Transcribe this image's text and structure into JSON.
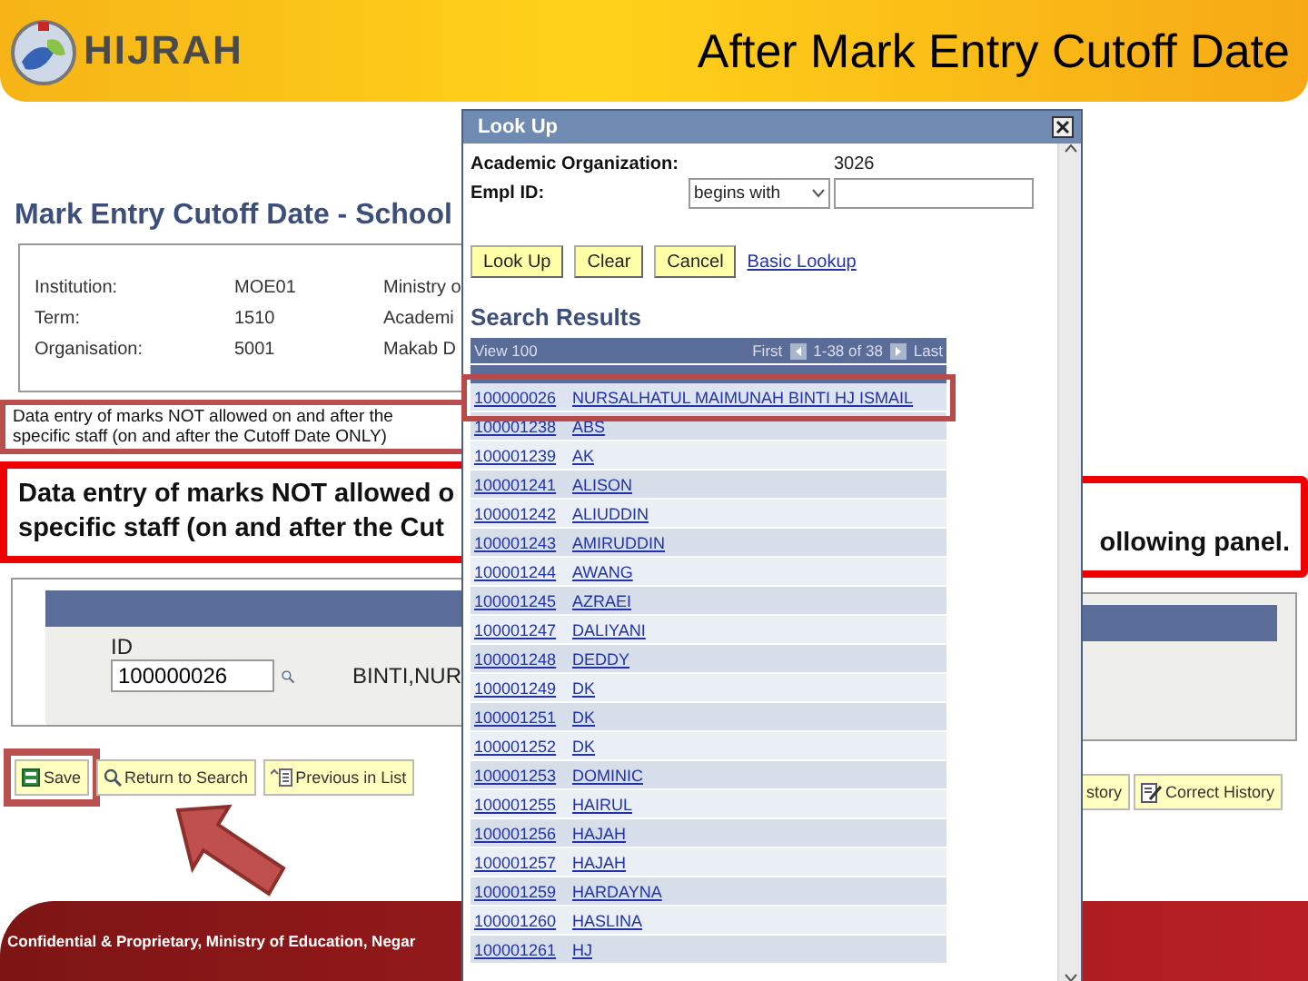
{
  "slide": {
    "logo_text": "HIJRAH",
    "title": "After Mark Entry Cutoff Date",
    "footer": "Confidential & Proprietary, Ministry of Education, Negar"
  },
  "page": {
    "title": "Mark Entry Cutoff Date - School",
    "fields": [
      {
        "label": "Institution:",
        "code": "MOE01",
        "description": "Ministry o"
      },
      {
        "label": "Term:",
        "code": "1510",
        "description": "Academi"
      },
      {
        "label": "Organisation:",
        "code": "5001",
        "description": "Makab D"
      }
    ],
    "notice": [
      "Data entry of marks NOT allowed on and after the",
      "specific staff (on and after the Cutoff Date  ONLY)"
    ],
    "callout": [
      "Data entry of marks NOT allowed o",
      "specific staff (on and after the Cut"
    ],
    "callout_end": "ollowing panel.",
    "id_label": "ID",
    "id_value": "100000026",
    "name": "BINTI,NUR",
    "buttons": [
      {
        "kind": "save",
        "label": "Save",
        "highlighted": true
      },
      {
        "kind": "search",
        "label": "Return to Search",
        "highlighted": false
      },
      {
        "kind": "previous",
        "label": "Previous in List",
        "highlighted": false
      }
    ],
    "right_buttons": [
      {
        "kind": "plain",
        "label": "story"
      },
      {
        "kind": "correct",
        "label": "Correct History"
      }
    ]
  },
  "lookup": {
    "title": "Look Up",
    "org_label": "Academic Organization:",
    "org_value": "3026",
    "empl_label": "Empl ID:",
    "operator": "begins with",
    "buttons": [
      "Look Up",
      "Clear",
      "Cancel"
    ],
    "basic_link": "Basic Lookup",
    "results_title": "Search Results",
    "view": "View 100",
    "first": "First",
    "range": "1-38 of 38",
    "last": "Last",
    "rows": [
      {
        "id": "100000026",
        "name": "NURSALHATUL MAIMUNAH BINTI HJ ISMAIL",
        "selected": true
      },
      {
        "id": "100001238",
        "name": "ABS",
        "selected": false
      },
      {
        "id": "100001239",
        "name": "AK",
        "selected": false
      },
      {
        "id": "100001241",
        "name": "ALISON",
        "selected": false
      },
      {
        "id": "100001242",
        "name": "ALIUDDIN",
        "selected": false
      },
      {
        "id": "100001243",
        "name": "AMIRUDDIN",
        "selected": false
      },
      {
        "id": "100001244",
        "name": "AWANG",
        "selected": false
      },
      {
        "id": "100001245",
        "name": "AZRAEI",
        "selected": false
      },
      {
        "id": "100001247",
        "name": "DALIYANI",
        "selected": false
      },
      {
        "id": "100001248",
        "name": "DEDDY",
        "selected": false
      },
      {
        "id": "100001249",
        "name": "DK",
        "selected": false
      },
      {
        "id": "100001251",
        "name": "DK",
        "selected": false
      },
      {
        "id": "100001252",
        "name": "DK",
        "selected": false
      },
      {
        "id": "100001253",
        "name": "DOMINIC",
        "selected": false
      },
      {
        "id": "100001255",
        "name": "HAIRUL",
        "selected": false
      },
      {
        "id": "100001256",
        "name": "HAJAH",
        "selected": false
      },
      {
        "id": "100001257",
        "name": "HAJAH",
        "selected": false
      },
      {
        "id": "100001259",
        "name": "HARDAYNA",
        "selected": false
      },
      {
        "id": "100001260",
        "name": "HASLINA",
        "selected": false
      },
      {
        "id": "100001261",
        "name": "HJ",
        "selected": false
      }
    ]
  }
}
